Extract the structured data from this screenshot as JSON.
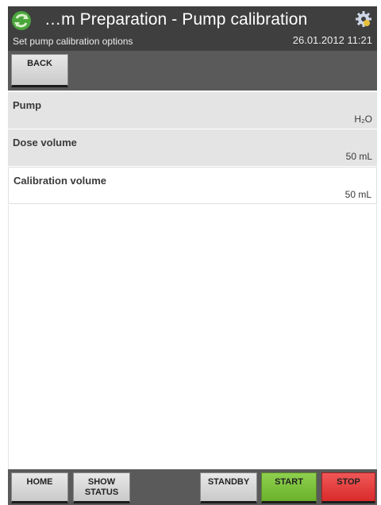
{
  "header": {
    "title": "…m Preparation - Pump calibration",
    "subtitle": "Set pump calibration options",
    "datetime": "26.01.2012 11:21",
    "app_icon": "recycle-icon",
    "settings_icon": "gear-icon"
  },
  "toolbar": {
    "back_label": "BACK"
  },
  "options": [
    {
      "label": "Pump",
      "value": "H₂O"
    },
    {
      "label": "Dose volume",
      "value": "50 mL"
    },
    {
      "label": "Calibration volume",
      "value": "50 mL"
    }
  ],
  "footer": {
    "home_label": "HOME",
    "show_status_label": "SHOW STATUS",
    "standby_label": "STANDBY",
    "start_label": "START",
    "stop_label": "STOP"
  },
  "colors": {
    "header_bg": "#3f3f3f",
    "toolbar_bg": "#5a5a5a",
    "start": "#7cc23c",
    "stop": "#e33b3b"
  }
}
